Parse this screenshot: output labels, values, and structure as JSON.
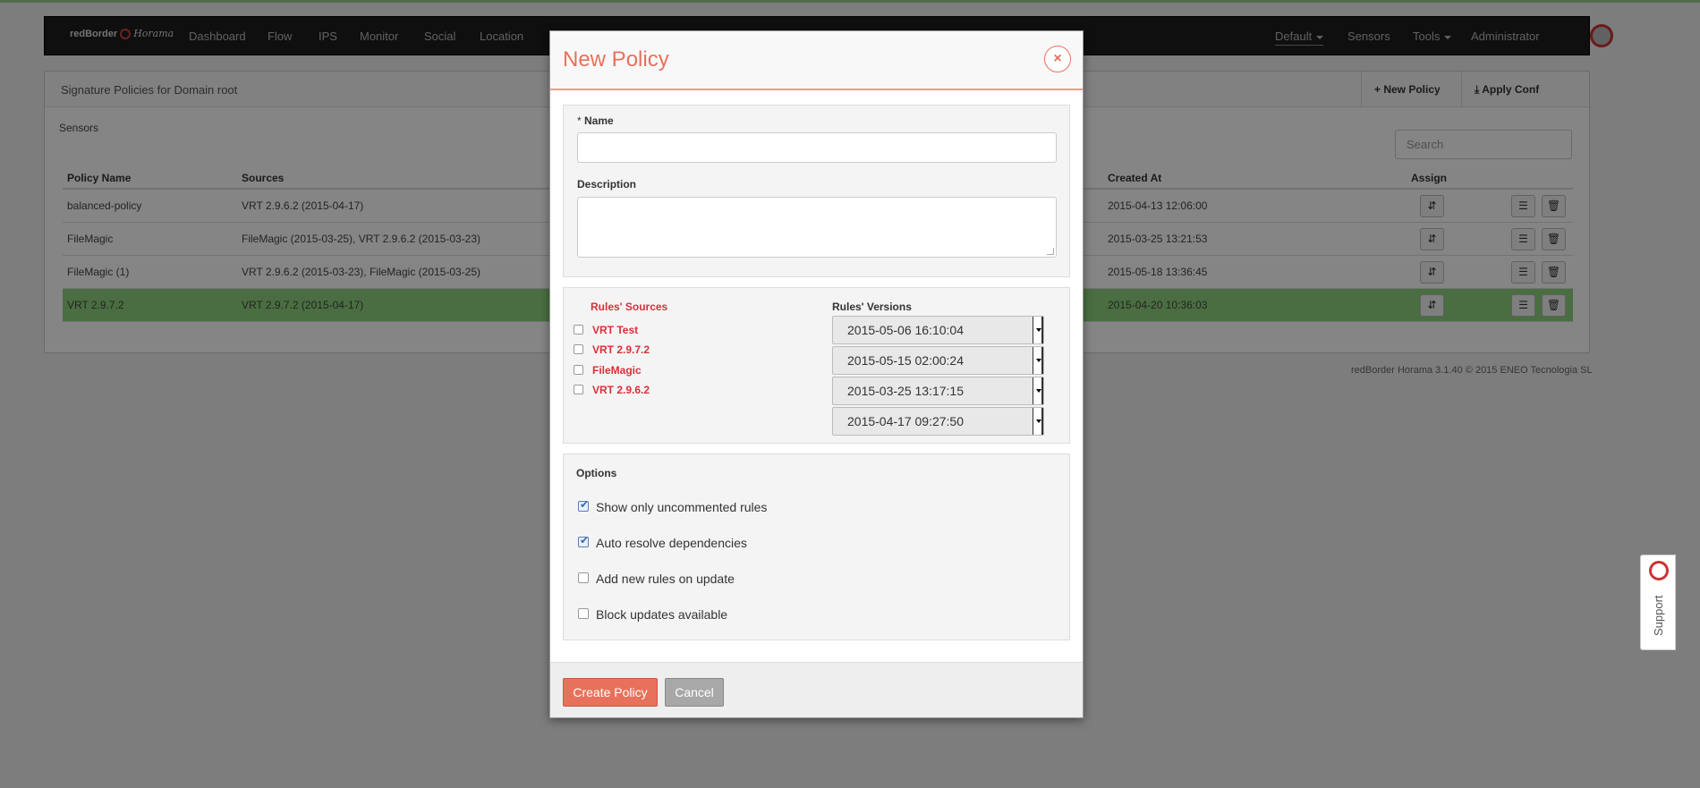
{
  "navbar": {
    "brand": "redBorder",
    "brand_sub": "Horama",
    "items": [
      "Dashboard",
      "Flow",
      "IPS",
      "Monitor",
      "Social",
      "Location"
    ],
    "right": {
      "domain": "Default",
      "sensors": "Sensors",
      "tools": "Tools",
      "user": "Administrator"
    }
  },
  "panel": {
    "title": "Signature Policies for Domain root",
    "new_policy": "New Policy",
    "apply_conf": "Apply Conf",
    "sensors_label": "Sensors",
    "search_placeholder": "Search",
    "columns": {
      "name": "Policy Name",
      "sources": "Sources",
      "created": "Created At",
      "assign": "Assign"
    },
    "rows": [
      {
        "name": "balanced-policy",
        "sources": "VRT 2.9.6.2 (2015-04-17)",
        "created": "2015-04-13 12:06:00"
      },
      {
        "name": "FileMagic",
        "sources": "FileMagic (2015-03-25), VRT 2.9.6.2 (2015-03-23)",
        "created": "2015-03-25 13:21:53"
      },
      {
        "name": "FileMagic (1)",
        "sources": "VRT 2.9.6.2 (2015-03-23), FileMagic (2015-03-25)",
        "created": "2015-05-18 13:36:45"
      },
      {
        "name": "VRT 2.9.7.2",
        "sources": "VRT 2.9.7.2 (2015-04-17)",
        "created": "2015-04-20 10:36:03"
      }
    ],
    "selected_row_color": "#8fd37e"
  },
  "footer": "redBorder Horama 3.1.40 © 2015 ENEO Tecnologia SL",
  "support_label": "Support",
  "modal": {
    "title": "New Policy",
    "close_glyph": "×",
    "name_req": "*",
    "name_label": "Name",
    "name_value": "",
    "description_label": "Description",
    "description_value": "",
    "sources_title": "Rules' Sources",
    "versions_title": "Rules' Versions",
    "sources": [
      {
        "label": "VRT Test",
        "checked": false
      },
      {
        "label": "VRT 2.9.7.2",
        "checked": false
      },
      {
        "label": "FileMagic",
        "checked": false
      },
      {
        "label": "VRT 2.9.6.2",
        "checked": false
      }
    ],
    "versions": [
      "2015-05-06 16:10:04",
      "2015-05-15 02:00:24",
      "2015-03-25 13:17:15",
      "2015-04-17 09:27:50"
    ],
    "options_title": "Options",
    "options": [
      {
        "label": "Show only uncommented rules",
        "checked": true
      },
      {
        "label": "Auto resolve dependencies",
        "checked": true
      },
      {
        "label": "Add new rules on update",
        "checked": false
      },
      {
        "label": "Block updates available",
        "checked": false
      }
    ],
    "create_button": "Create Policy",
    "cancel_button": "Cancel",
    "accent_color": "#e8715c",
    "source_color": "#d9303a"
  }
}
